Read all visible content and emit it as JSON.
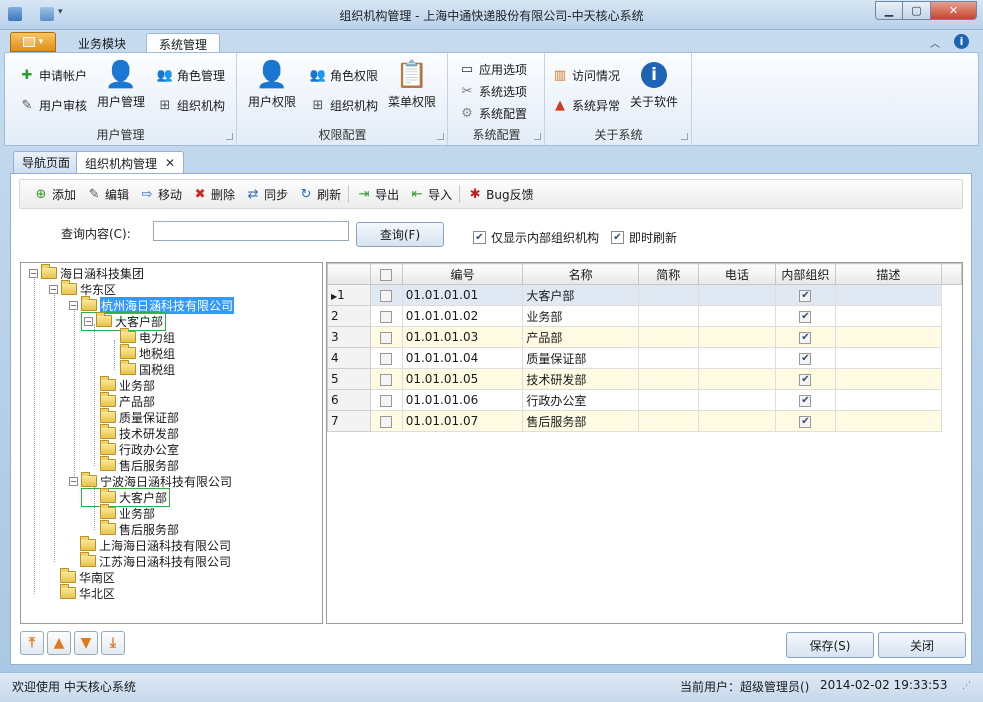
{
  "window": {
    "title": "组织机构管理 - 上海中通快递股份有限公司-中天核心系统"
  },
  "ribbon_tabs": [
    {
      "label": "业务模块"
    },
    {
      "label": "系统管理"
    }
  ],
  "ribbon": {
    "user_group": {
      "label": "用户管理",
      "apply_account": "申请帐户",
      "user_review": "用户审核",
      "user_manage": "用户管理",
      "role_manage": "角色管理",
      "org": "组织机构"
    },
    "perm_group": {
      "label": "权限配置",
      "user_perm": "用户权限",
      "role_perm": "角色权限",
      "org": "组织机构",
      "menu_perm": "菜单权限"
    },
    "config_group": {
      "label": "系统配置",
      "app_options": "应用选项",
      "sys_options": "系统选项",
      "sys_config": "系统配置"
    },
    "about_group": {
      "label": "关于系统",
      "visits": "访问情况",
      "errors": "系统异常",
      "about": "关于软件"
    }
  },
  "doc_tabs": [
    {
      "label": "导航页面"
    },
    {
      "label": "组织机构管理"
    }
  ],
  "toolbar": {
    "add": "添加",
    "edit": "编辑",
    "move": "移动",
    "delete": "删除",
    "sync": "同步",
    "refresh": "刷新",
    "export": "导出",
    "import": "导入",
    "bug": "Bug反馈"
  },
  "search": {
    "label": "查询内容(C):",
    "value": "",
    "button": "查询(F)",
    "only_internal": "仅显示内部组织机构",
    "auto_refresh": "即时刷新"
  },
  "tree": {
    "root": "海日涵科技集团",
    "east": "华东区",
    "hz": "杭州海日涵科技有限公司",
    "hz_big": "大客户部",
    "power": "电力组",
    "local_tax": "地税组",
    "state_tax": "国税组",
    "hz_biz": "业务部",
    "hz_prod": "产品部",
    "hz_qa": "质量保证部",
    "hz_rd": "技术研发部",
    "hz_admin": "行政办公室",
    "hz_aftersale": "售后服务部",
    "nb": "宁波海日涵科技有限公司",
    "nb_big": "大客户部",
    "nb_biz": "业务部",
    "nb_aftersale": "售后服务部",
    "sh": "上海海日涵科技有限公司",
    "js": "江苏海日涵科技有限公司",
    "south": "华南区",
    "north": "华北区"
  },
  "grid": {
    "columns": [
      "编号",
      "名称",
      "简称",
      "电话",
      "内部组织",
      "描述"
    ],
    "rows": [
      {
        "n": "1",
        "code": "01.01.01.01",
        "name": "大客户部"
      },
      {
        "n": "2",
        "code": "01.01.01.02",
        "name": "业务部"
      },
      {
        "n": "3",
        "code": "01.01.01.03",
        "name": "产品部"
      },
      {
        "n": "4",
        "code": "01.01.01.04",
        "name": "质量保证部"
      },
      {
        "n": "5",
        "code": "01.01.01.05",
        "name": "技术研发部"
      },
      {
        "n": "6",
        "code": "01.01.01.06",
        "name": "行政办公室"
      },
      {
        "n": "7",
        "code": "01.01.01.07",
        "name": "售后服务部"
      }
    ]
  },
  "actions": {
    "save": "保存(S)",
    "close": "关闭"
  },
  "status": {
    "welcome": "欢迎使用 中天核心系统",
    "user": "当前用户：超级管理员()",
    "datetime": "2014-02-02 19:33:53"
  },
  "colors": {
    "accent": "#3399ff",
    "row_alt": "#fffbe3",
    "app_menu": "#e28d17"
  }
}
